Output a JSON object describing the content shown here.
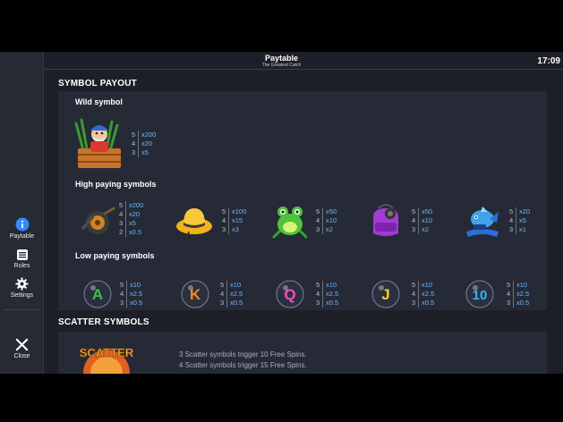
{
  "header": {
    "title": "Paytable",
    "subtitle": "The Greatest Catch",
    "time": "17:09"
  },
  "sidebar": {
    "items": [
      {
        "label": "Paytable",
        "icon": "info-icon",
        "active": true
      },
      {
        "label": "Rules",
        "icon": "rules-list-icon",
        "active": false
      },
      {
        "label": "Settings",
        "icon": "gear-icon",
        "active": false
      },
      {
        "label": "Close",
        "icon": "close-icon",
        "active": false
      }
    ]
  },
  "symbol_payout": {
    "title": "SYMBOL PAYOUT",
    "wild": {
      "heading": "Wild symbol",
      "symbol": {
        "name": "fisherman-wild-icon",
        "pays": [
          {
            "count": "5",
            "mult": "x200"
          },
          {
            "count": "4",
            "mult": "x20"
          },
          {
            "count": "3",
            "mult": "x5"
          }
        ]
      }
    },
    "high": {
      "heading": "High paying symbols",
      "symbols": [
        {
          "name": "fishing-reel-icon",
          "pays": [
            {
              "count": "5",
              "mult": "x200"
            },
            {
              "count": "4",
              "mult": "x20"
            },
            {
              "count": "3",
              "mult": "x5"
            },
            {
              "count": "2",
              "mult": "x0.5"
            }
          ]
        },
        {
          "name": "straw-hat-icon",
          "pays": [
            {
              "count": "5",
              "mult": "x100"
            },
            {
              "count": "4",
              "mult": "x15"
            },
            {
              "count": "3",
              "mult": "x3"
            }
          ]
        },
        {
          "name": "frog-icon",
          "pays": [
            {
              "count": "5",
              "mult": "x50"
            },
            {
              "count": "4",
              "mult": "x10"
            },
            {
              "count": "3",
              "mult": "x2"
            }
          ]
        },
        {
          "name": "tackle-bag-icon",
          "pays": [
            {
              "count": "5",
              "mult": "x50"
            },
            {
              "count": "4",
              "mult": "x10"
            },
            {
              "count": "3",
              "mult": "x2"
            }
          ]
        },
        {
          "name": "fish-icon",
          "pays": [
            {
              "count": "5",
              "mult": "x20"
            },
            {
              "count": "4",
              "mult": "x5"
            },
            {
              "count": "3",
              "mult": "x1"
            }
          ]
        }
      ]
    },
    "low": {
      "heading": "Low paying symbols",
      "symbols": [
        {
          "name": "letter-a-bubble-icon",
          "letter": "A",
          "color": "#39c24a",
          "pays": [
            {
              "count": "5",
              "mult": "x10"
            },
            {
              "count": "4",
              "mult": "x2.5"
            },
            {
              "count": "3",
              "mult": "x0.5"
            }
          ]
        },
        {
          "name": "letter-k-bubble-icon",
          "letter": "K",
          "color": "#ff8a1f",
          "pays": [
            {
              "count": "5",
              "mult": "x10"
            },
            {
              "count": "4",
              "mult": "x2.5"
            },
            {
              "count": "3",
              "mult": "x0.5"
            }
          ]
        },
        {
          "name": "letter-q-bubble-icon",
          "letter": "Q",
          "color": "#ff4fb4",
          "pays": [
            {
              "count": "5",
              "mult": "x10"
            },
            {
              "count": "4",
              "mult": "x2.5"
            },
            {
              "count": "3",
              "mult": "x0.5"
            }
          ]
        },
        {
          "name": "letter-j-bubble-icon",
          "letter": "J",
          "color": "#ffd21f",
          "pays": [
            {
              "count": "5",
              "mult": "x10"
            },
            {
              "count": "4",
              "mult": "x2.5"
            },
            {
              "count": "3",
              "mult": "x0.5"
            }
          ]
        },
        {
          "name": "letter-10-bubble-icon",
          "letter": "10",
          "color": "#2fb4ff",
          "pays": [
            {
              "count": "5",
              "mult": "x10"
            },
            {
              "count": "4",
              "mult": "x2.5"
            },
            {
              "count": "3",
              "mult": "x0.5"
            }
          ]
        }
      ]
    }
  },
  "scatter": {
    "title": "SCATTER SYMBOLS",
    "lines": [
      "3 Scatter symbols trigger 10 Free Spins.",
      "4 Scatter symbols trigger 15 Free Spins."
    ]
  },
  "colors": {
    "background": "#1c1f27",
    "panel": "#252a36",
    "sidebar": "#252a35",
    "accent": "#2f8cff",
    "multiplier": "#6fb6ff"
  }
}
